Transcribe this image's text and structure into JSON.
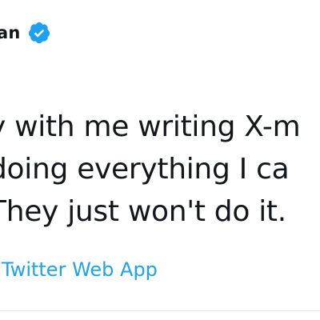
{
  "author": {
    "name_fragment": "an",
    "verified_icon": "verified-badge-icon"
  },
  "tweet": {
    "lines": [
      "y with me writing X-m",
      "doing everything I ca",
      "They just won't do it."
    ],
    "source": "Twitter Web App"
  },
  "colors": {
    "text": "#14171a",
    "link": "#1da1f2",
    "verified": "#1da1f2",
    "divider": "#e1e8ed"
  }
}
